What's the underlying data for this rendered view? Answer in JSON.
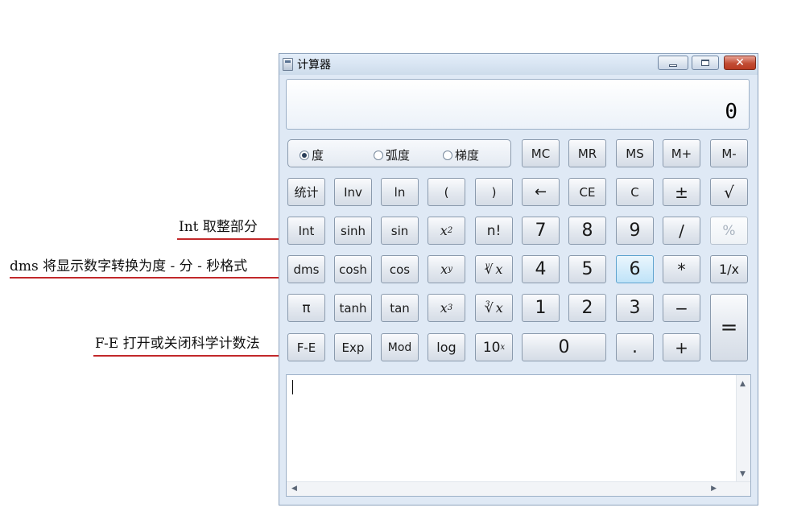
{
  "window": {
    "title": "计算器"
  },
  "display": {
    "value": "0"
  },
  "angle_modes": [
    {
      "label": "度",
      "selected": true
    },
    {
      "label": "弧度",
      "selected": false
    },
    {
      "label": "梯度",
      "selected": false
    }
  ],
  "memory_buttons": [
    "MC",
    "MR",
    "MS",
    "M+",
    "M-"
  ],
  "buttons": {
    "stat": "统计",
    "inv": "Inv",
    "ln": "ln",
    "lparen": "(",
    "rparen": ")",
    "backspace": "←",
    "ce": "CE",
    "c": "C",
    "plusminus": "±",
    "sqrt": "√",
    "int": "Int",
    "sinh": "sinh",
    "sin": "sin",
    "x2_base": "x",
    "x2_exp": "2",
    "nfact": "n!",
    "n7": "7",
    "n8": "8",
    "n9": "9",
    "div": "/",
    "percent": "%",
    "dms": "dms",
    "cosh": "cosh",
    "cos": "cos",
    "xy_base": "x",
    "xy_exp": "y",
    "yroot_index": "y",
    "yroot_sym": "√",
    "yroot_x": "x",
    "n4": "4",
    "n5": "5",
    "n6": "6",
    "mul": "*",
    "recip": "1/x",
    "pi": "π",
    "tanh": "tanh",
    "tan": "tan",
    "x3_base": "x",
    "x3_exp": "3",
    "croot_index": "3",
    "croot_sym": "√",
    "croot_x": "x",
    "n1": "1",
    "n2": "2",
    "n3": "3",
    "minus": "−",
    "equals": "=",
    "fe": "F-E",
    "exp": "Exp",
    "mod": "Mod",
    "log": "log",
    "ten_base": "10",
    "ten_exp": "x",
    "n0": "0",
    "dot": ".",
    "plus": "+"
  },
  "annotations": {
    "int": "Int 取整部分",
    "dms": "dms 将显示数字转换为度 - 分 - 秒格式",
    "fe": "F-E 打开或关闭科学计数法"
  },
  "colors": {
    "annotation_line": "#c2282a",
    "window_bg": "#dfe9f5",
    "close_button": "#c24c34"
  }
}
